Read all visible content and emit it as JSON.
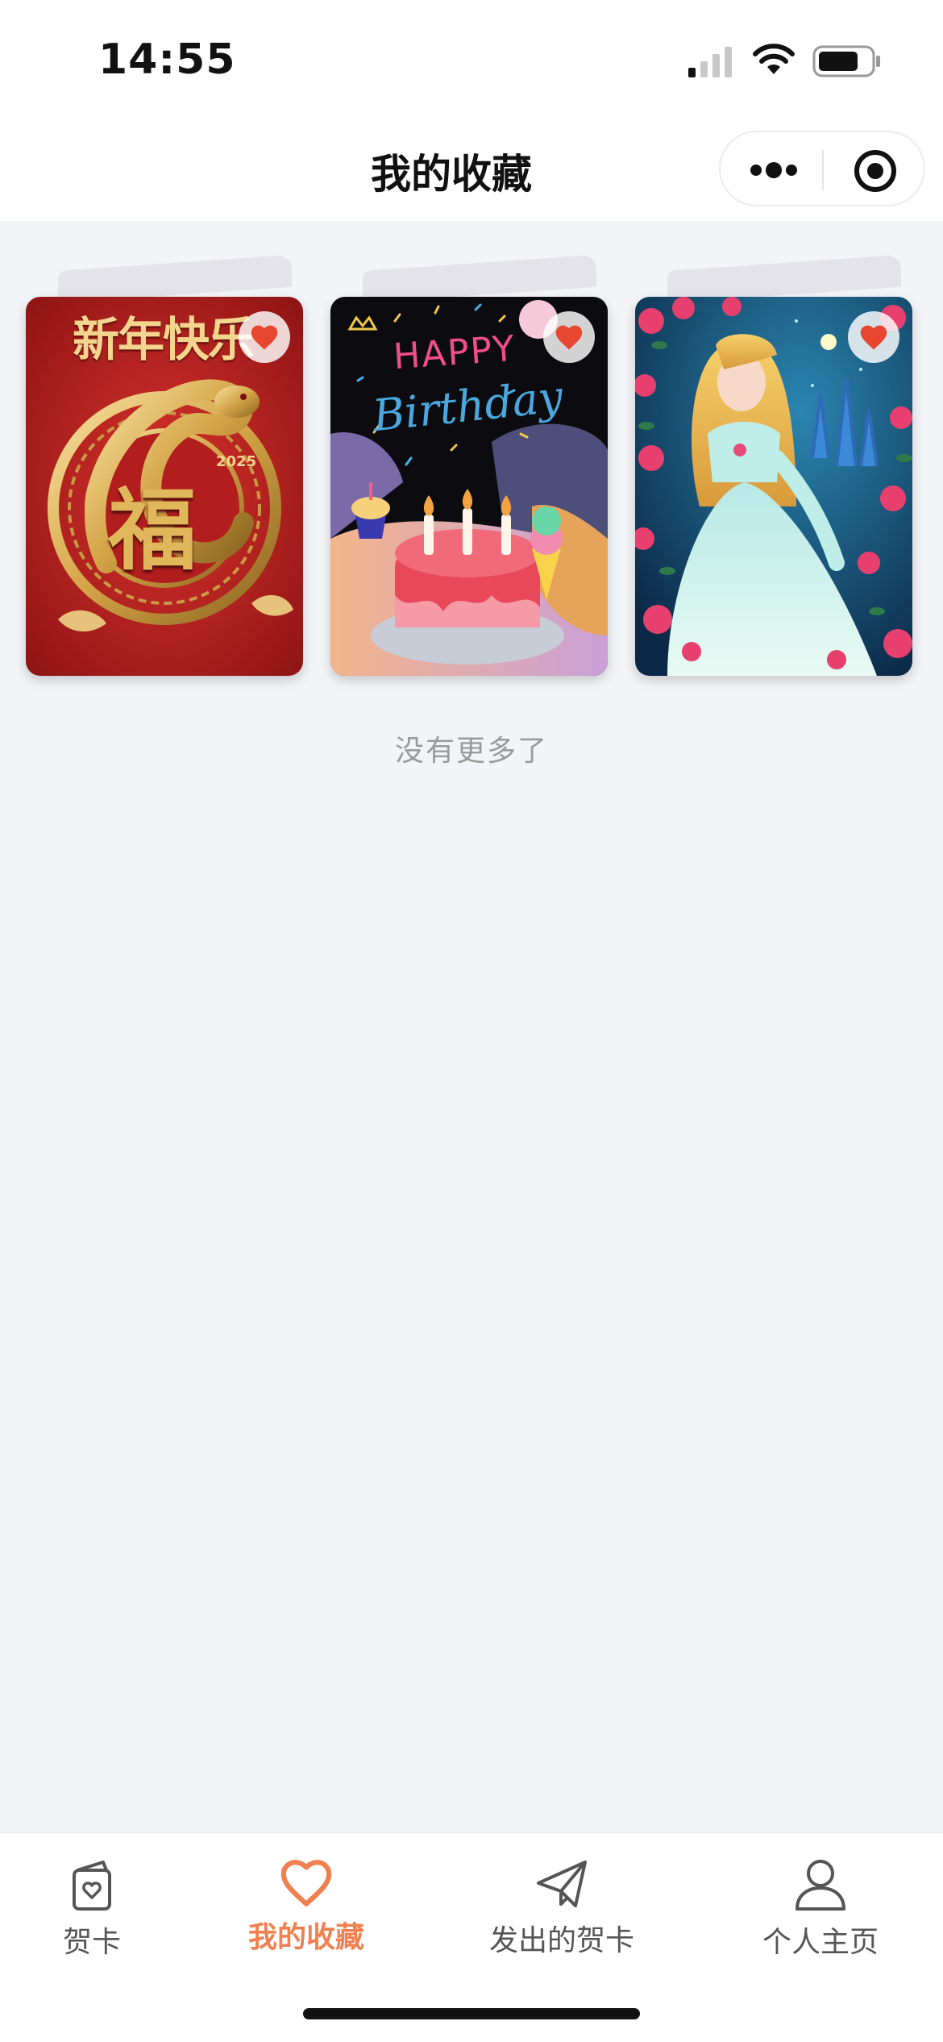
{
  "status_bar": {
    "time": "14:55"
  },
  "nav": {
    "title": "我的收藏"
  },
  "cards": [
    {
      "name": "new-year-card",
      "title_text": "新年快乐",
      "center_text": "福",
      "year_text": "2025",
      "favorited": true
    },
    {
      "name": "birthday-card",
      "line1": "HAPPY",
      "line2": "Birthday",
      "favorited": true
    },
    {
      "name": "princess-card",
      "favorited": true
    }
  ],
  "list_footer": "没有更多了",
  "tabbar": {
    "items": [
      {
        "label": "贺卡",
        "icon": "card-bag-icon"
      },
      {
        "label": "我的收藏",
        "icon": "heart-icon",
        "active": true
      },
      {
        "label": "发出的贺卡",
        "icon": "paper-plane-icon"
      },
      {
        "label": "个人主页",
        "icon": "person-icon"
      }
    ]
  },
  "colors": {
    "accent": "#f08050",
    "heart": "#e8462e",
    "background": "#f3f4f8"
  }
}
